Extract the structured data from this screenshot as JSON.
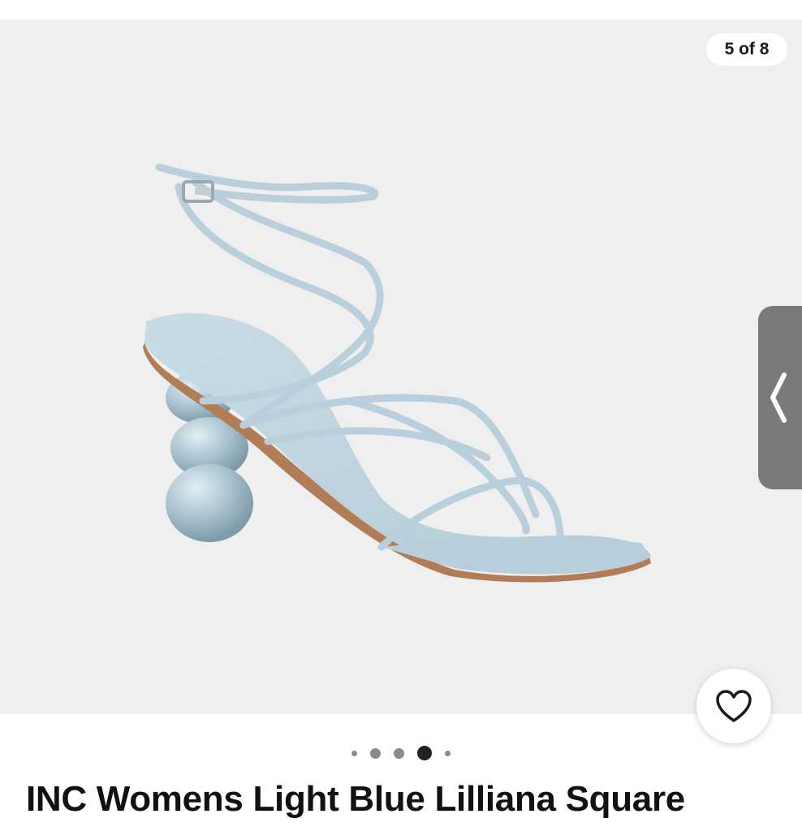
{
  "gallery": {
    "counter": "5 of 8",
    "image_alt": "Light blue strappy sandal with sphere heel",
    "total_dots": 5,
    "active_dot": 3
  },
  "product": {
    "title": "INC Womens Light Blue Lilliana Square"
  },
  "icons": {
    "favorite": "heart-icon",
    "prev": "chevron-left-icon"
  },
  "colors": {
    "sandal": "#bcd3df",
    "background": "#efefef"
  }
}
